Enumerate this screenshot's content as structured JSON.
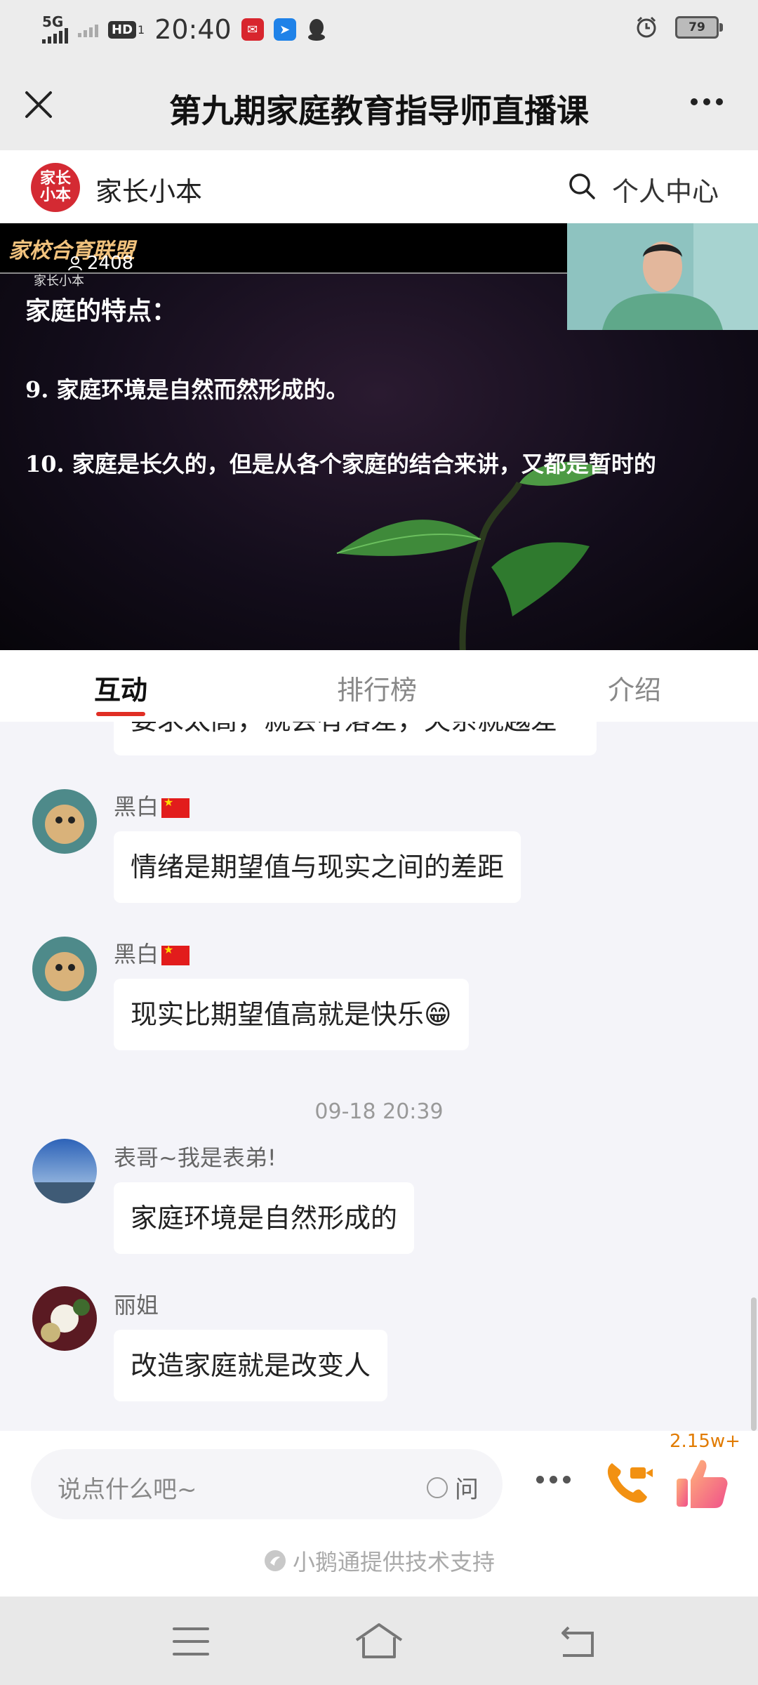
{
  "status_bar": {
    "network": "5G",
    "hd": "HD",
    "hd_sub": "1",
    "time": "20:40",
    "battery": "79"
  },
  "title_bar": {
    "title": "第九期家庭教育指导师直播课"
  },
  "channel": {
    "logo_text": "家长小本",
    "name": "家长小本",
    "center_link": "个人中心"
  },
  "video": {
    "brand": "家校合育联盟",
    "brand_sub": "家长小本",
    "viewer_count": "2408",
    "slide_heading": "家庭的特点：",
    "slide_point_9": "9. 家庭环境是自然而然形成的。",
    "slide_point_10": "10. 家庭是长久的，但是从各个家庭的结合来讲，又都是暂时的"
  },
  "tabs": [
    {
      "label": "互动",
      "active": true
    },
    {
      "label": "排行榜",
      "active": false
    },
    {
      "label": "介绍",
      "active": false
    }
  ],
  "chat": {
    "partial_message": "要求太高，就会有落差，失系就越差",
    "messages": [
      {
        "user": "黑白",
        "text": "情绪是期望值与现实之间的差距"
      },
      {
        "user": "黑白",
        "text": "现实比期望值高就是快乐😁"
      },
      {
        "user": "表哥~我是表弟!",
        "text": "家庭环境是自然形成的"
      },
      {
        "user": "丽姐",
        "text": "改造家庭就是改变人"
      }
    ],
    "timestamp": "09-18 20:39"
  },
  "input_bar": {
    "placeholder": "说点什么吧~",
    "ask_label": "问",
    "like_count": "2.15w+",
    "powered_by": "小鹅通提供技术支持"
  },
  "colors": {
    "accent": "#e02e24",
    "like_orange": "#e17b00"
  },
  "icons": [
    "close-icon",
    "more-icon",
    "search-icon",
    "user-icon",
    "call-icon",
    "like-icon",
    "menu-icon",
    "home-icon",
    "back-icon"
  ]
}
